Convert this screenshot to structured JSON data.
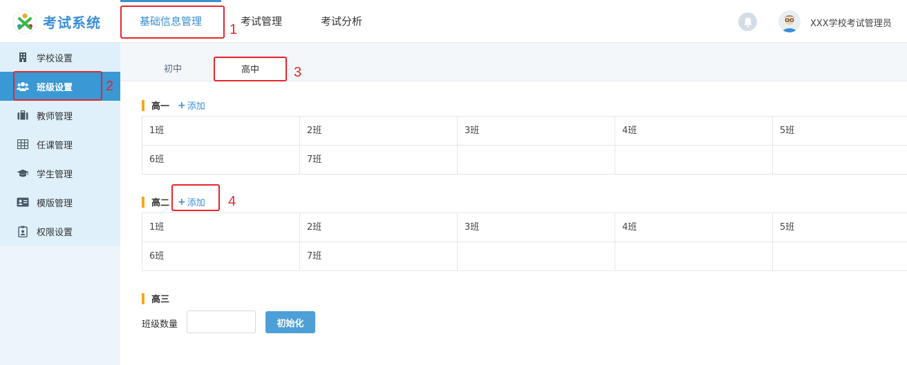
{
  "app": {
    "title": "考试系统",
    "user": "XXX学校考试管理员"
  },
  "top_nav": [
    {
      "label": "基础信息管理",
      "active": true
    },
    {
      "label": "考试管理",
      "active": false
    },
    {
      "label": "考试分析",
      "active": false
    }
  ],
  "sidebar": {
    "items": [
      {
        "label": "学校设置",
        "icon": "building-icon",
        "active": false
      },
      {
        "label": "班级设置",
        "icon": "group-icon",
        "active": true
      },
      {
        "label": "教师管理",
        "icon": "briefcase-icon",
        "active": false
      },
      {
        "label": "任课管理",
        "icon": "table-icon",
        "active": false
      },
      {
        "label": "学生管理",
        "icon": "graduation-cap-icon",
        "active": false
      },
      {
        "label": "模版管理",
        "icon": "id-card-icon",
        "active": false
      },
      {
        "label": "权限设置",
        "icon": "badge-icon",
        "active": false
      }
    ]
  },
  "tabs": [
    {
      "label": "初中",
      "active": false
    },
    {
      "label": "高中",
      "active": true
    }
  ],
  "grades": [
    {
      "name": "高一",
      "add_label": "添加",
      "rows": [
        [
          "1班",
          "2班",
          "3班",
          "4班",
          "5班"
        ],
        [
          "6班",
          "7班",
          "",
          "",
          ""
        ]
      ]
    },
    {
      "name": "高二",
      "add_label": "添加",
      "rows": [
        [
          "1班",
          "2班",
          "3班",
          "4班",
          "5班"
        ],
        [
          "6班",
          "7班",
          "",
          "",
          ""
        ]
      ]
    },
    {
      "name": "高三"
    }
  ],
  "init_form": {
    "count_label": "班级数量",
    "count_value": "",
    "button_label": "初始化"
  },
  "annotations": [
    "1",
    "2",
    "3",
    "4"
  ],
  "colors": {
    "accent": "#3a8ed6",
    "sidebar_active": "#3a98d4",
    "grade_bar": "#f5a623",
    "annotation": "#e8242c"
  }
}
